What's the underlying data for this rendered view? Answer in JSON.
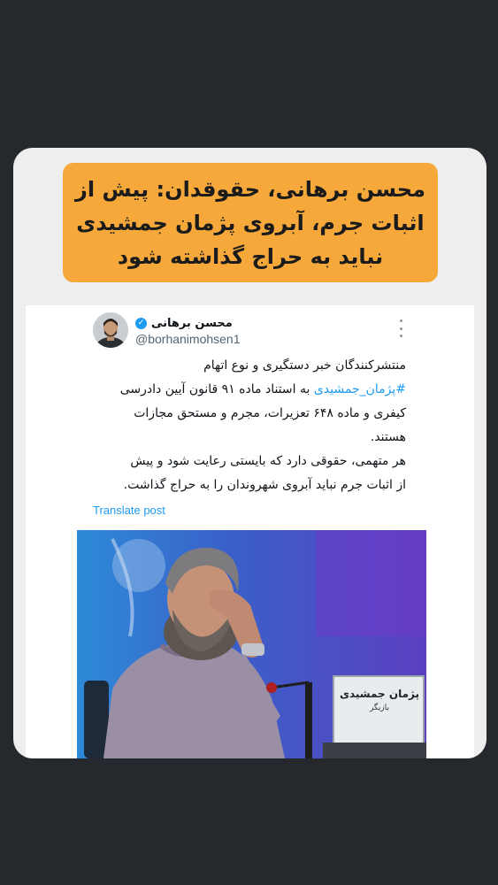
{
  "headline": {
    "line1": "محسن برهانی، حقوقدان: پیش از",
    "line2": "اثبات جرم، آبروی پژمان جمشیدی",
    "line3": "نباید به حراج گذاشته شود"
  },
  "tweet": {
    "author_name": "محسن برهانی",
    "handle": "@borhanimohsen1",
    "paragraph1_line1": "منتشرکنندگان خبر دستگیری و نوع اتهام",
    "hashtag": "#پژمان_جمشیدی",
    "paragraph1_line2_rest": " به استناد ماده ۹۱ قانون آیین دادرسی",
    "paragraph1_line3": "کیفری و ماده ۶۴۸ تعزیرات، مجرم و مستحق مجازات",
    "paragraph1_line4": "هستند.",
    "paragraph2_line1": "هر متهمی، حقوقی دارد که بایستی رعایت شود و پیش",
    "paragraph2_line2": "از اثبات جرم نباید آبروی شهروندان را به حراج گذاشت.",
    "translate_label": "Translate post"
  },
  "photo": {
    "placard_name": "پژمان جمشیدی",
    "placard_role": "بازیگر"
  },
  "colors": {
    "background": "#25282d",
    "headline_bg": "#f6a93a",
    "link": "#1d9bf0"
  }
}
